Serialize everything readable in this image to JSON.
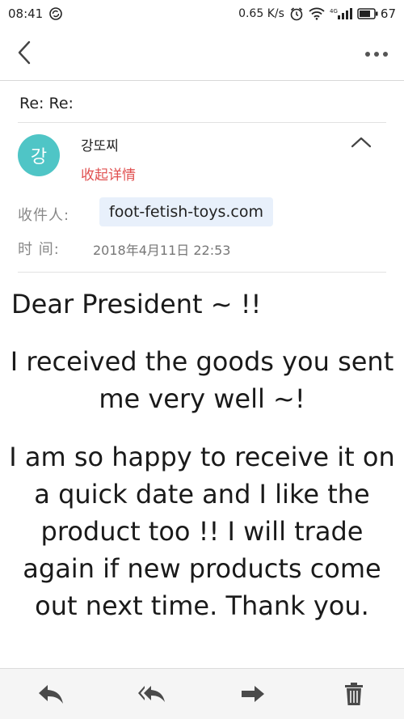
{
  "status_bar": {
    "time": "08:41",
    "speed": "0.65 K/s",
    "network": "4G",
    "battery": "67"
  },
  "email": {
    "subject": "Re: Re:",
    "sender_initial": "강",
    "sender_name": "강또찌",
    "collapse_label": "收起详情",
    "recipient_label": "收件人:",
    "recipient": "foot-fetish-toys.com",
    "time_label": "时  间:",
    "time_value": "2018年4月11日 22:53",
    "body": {
      "greeting": "Dear President ~ !!",
      "para1": "I received the goods you sent me very well ~!",
      "para2": "I am so happy to receive it on a quick date and I like the product too !! I will trade again if new products come out next time. Thank you."
    }
  },
  "colors": {
    "avatar_bg": "#4fc5c6",
    "collapse_link": "#e05050",
    "recipient_chip_bg": "#e8f0fb"
  },
  "icons": {
    "back": "chevron-left-icon",
    "more": "more-horizontal-icon",
    "collapse": "chevron-up-icon",
    "reply": "reply-icon",
    "reply_all": "reply-all-icon",
    "forward": "forward-icon",
    "delete": "trash-icon"
  }
}
